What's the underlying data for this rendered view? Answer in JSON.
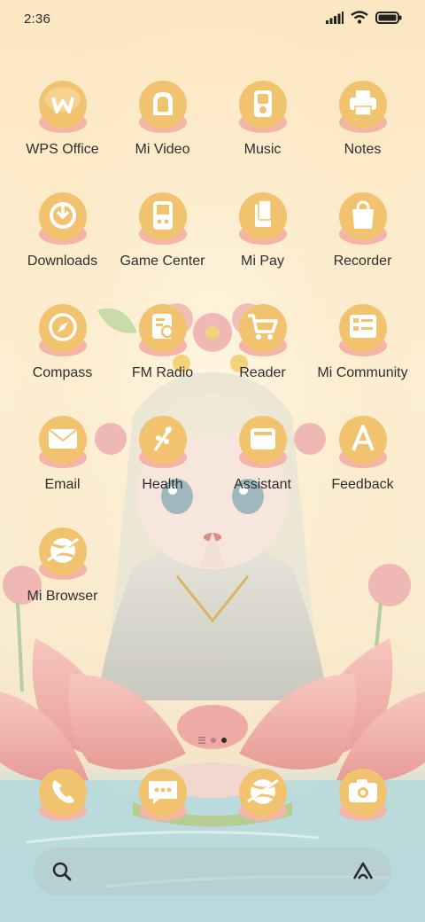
{
  "status_bar": {
    "time": "2:36",
    "icons": [
      "signal-icon",
      "wifi-icon",
      "battery-icon"
    ]
  },
  "apps": [
    {
      "label": "WPS Office",
      "icon": "wps-icon"
    },
    {
      "label": "Mi Video",
      "icon": "mi-video-icon"
    },
    {
      "label": "Music",
      "icon": "music-icon"
    },
    {
      "label": "Notes",
      "icon": "notes-icon"
    },
    {
      "label": "Downloads",
      "icon": "downloads-icon"
    },
    {
      "label": "Game Center",
      "icon": "game-center-icon"
    },
    {
      "label": "Mi Pay",
      "icon": "mi-pay-icon"
    },
    {
      "label": "Recorder",
      "icon": "recorder-icon"
    },
    {
      "label": "Compass",
      "icon": "compass-icon"
    },
    {
      "label": "FM Radio",
      "icon": "fm-radio-icon"
    },
    {
      "label": "Reader",
      "icon": "reader-icon"
    },
    {
      "label": "Mi Community",
      "icon": "mi-community-icon"
    },
    {
      "label": "Email",
      "icon": "email-icon"
    },
    {
      "label": "Health",
      "icon": "health-icon"
    },
    {
      "label": "Assistant",
      "icon": "assistant-icon"
    },
    {
      "label": "Feedback",
      "icon": "feedback-icon"
    },
    {
      "label": "Mi Browser",
      "icon": "mi-browser-icon"
    }
  ],
  "page_indicator": {
    "pages": 2,
    "current": 2
  },
  "dock": [
    {
      "icon": "phone-icon"
    },
    {
      "icon": "messages-icon"
    },
    {
      "icon": "browser-icon"
    },
    {
      "icon": "camera-icon"
    }
  ],
  "search_bar": {
    "icons": [
      "search-icon",
      "assistant-a-icon"
    ]
  },
  "colors": {
    "icon_bubble": "#f2c36f",
    "icon_glyph": "#ffffff",
    "lotus_petal": "#f2b7b0",
    "label_text": "#2f2f2f"
  }
}
